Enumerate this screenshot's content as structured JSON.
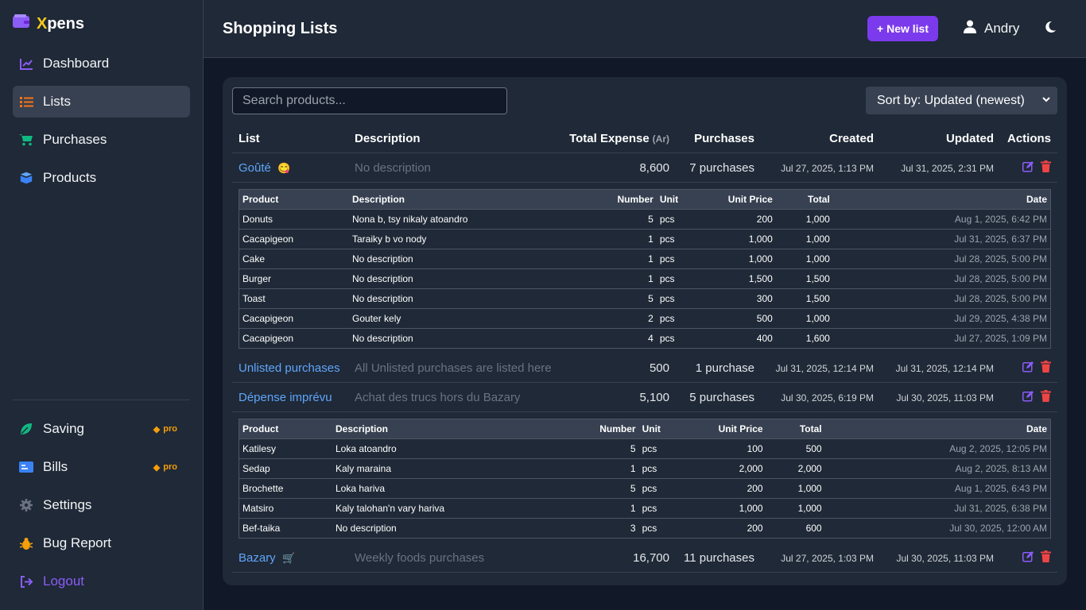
{
  "brand": {
    "first": "X",
    "rest": "pens"
  },
  "nav": [
    {
      "label": "Dashboard",
      "icon": "chart-line-icon"
    },
    {
      "label": "Lists",
      "icon": "list-icon",
      "active": true
    },
    {
      "label": "Purchases",
      "icon": "cart-icon"
    },
    {
      "label": "Products",
      "icon": "box-icon"
    }
  ],
  "nav2": [
    {
      "label": "Saving",
      "icon": "leaf-icon",
      "badge": "pro"
    },
    {
      "label": "Bills",
      "icon": "bill-icon",
      "badge": "pro"
    },
    {
      "label": "Settings",
      "icon": "gear-icon"
    },
    {
      "label": "Bug Report",
      "icon": "bug-icon"
    },
    {
      "label": "Logout",
      "icon": "logout-icon"
    }
  ],
  "header": {
    "title": "Shopping Lists",
    "new_button": "+ New list",
    "user": "Andry"
  },
  "search": {
    "placeholder": "Search products..."
  },
  "sort": {
    "value": "Sort by: Updated (newest)"
  },
  "columns": {
    "list": "List",
    "description": "Description",
    "total": "Total Expense",
    "total_unit": "(Ar)",
    "purchases": "Purchases",
    "created": "Created",
    "updated": "Updated",
    "actions": "Actions"
  },
  "sub_columns": {
    "product": "Product",
    "description": "Description",
    "number": "Number",
    "unit": "Unit",
    "unit_price": "Unit Price",
    "total": "Total",
    "date": "Date"
  },
  "lists": [
    {
      "name": "Goûté",
      "emoji": "😋",
      "description": "No description",
      "total": "8,600",
      "purchases": "7 purchases",
      "created": "Jul 27, 2025, 1:13 PM",
      "updated": "Jul 31, 2025, 2:31 PM",
      "items": [
        [
          "Donuts",
          "Nona b, tsy nikaly atoandro",
          "5",
          "pcs",
          "200",
          "1,000",
          "Aug 1, 2025, 6:42 PM"
        ],
        [
          "Cacapigeon",
          "Taraiky b vo nody",
          "1",
          "pcs",
          "1,000",
          "1,000",
          "Jul 31, 2025, 6:37 PM"
        ],
        [
          "Cake",
          "No description",
          "1",
          "pcs",
          "1,000",
          "1,000",
          "Jul 28, 2025, 5:00 PM"
        ],
        [
          "Burger",
          "No description",
          "1",
          "pcs",
          "1,500",
          "1,500",
          "Jul 28, 2025, 5:00 PM"
        ],
        [
          "Toast",
          "No description",
          "5",
          "pcs",
          "300",
          "1,500",
          "Jul 28, 2025, 5:00 PM"
        ],
        [
          "Cacapigeon",
          "Gouter kely",
          "2",
          "pcs",
          "500",
          "1,000",
          "Jul 29, 2025, 4:38 PM"
        ],
        [
          "Cacapigeon",
          "No description",
          "4",
          "pcs",
          "400",
          "1,600",
          "Jul 27, 2025, 1:09 PM"
        ]
      ]
    },
    {
      "name": "Unlisted purchases",
      "emoji": "",
      "description": "All Unlisted purchases are listed here",
      "total": "500",
      "purchases": "1 purchase",
      "created": "Jul 31, 2025, 12:14 PM",
      "updated": "Jul 31, 2025, 12:14 PM",
      "items": []
    },
    {
      "name": "Dépense imprévu",
      "emoji": "",
      "description": "Achat des trucs hors du Bazary",
      "total": "5,100",
      "purchases": "5 purchases",
      "created": "Jul 30, 2025, 6:19 PM",
      "updated": "Jul 30, 2025, 11:03 PM",
      "items": [
        [
          "Katilesy",
          "Loka atoandro",
          "5",
          "pcs",
          "100",
          "500",
          "Aug 2, 2025, 12:05 PM"
        ],
        [
          "Sedap",
          "Kaly maraina",
          "1",
          "pcs",
          "2,000",
          "2,000",
          "Aug 2, 2025, 8:13 AM"
        ],
        [
          "Brochette",
          "Loka hariva",
          "5",
          "pcs",
          "200",
          "1,000",
          "Aug 1, 2025, 6:43 PM"
        ],
        [
          "Matsiro",
          "Kaly talohan'n vary hariva",
          "1",
          "pcs",
          "1,000",
          "1,000",
          "Jul 31, 2025, 6:38 PM"
        ],
        [
          "Bef-taika",
          "No description",
          "3",
          "pcs",
          "200",
          "600",
          "Jul 30, 2025, 12:00 AM"
        ]
      ]
    },
    {
      "name": "Bazary",
      "emoji": "🛒",
      "description": "Weekly foods purchases",
      "total": "16,700",
      "purchases": "11 purchases",
      "created": "Jul 27, 2025, 1:03 PM",
      "updated": "Jul 30, 2025, 11:03 PM",
      "items": []
    }
  ],
  "colors": {
    "accent": "#7c3aed",
    "link": "#60a5fa",
    "edit": "#8b5cf6",
    "delete": "#ef4444",
    "pro": "#f59e0b"
  }
}
